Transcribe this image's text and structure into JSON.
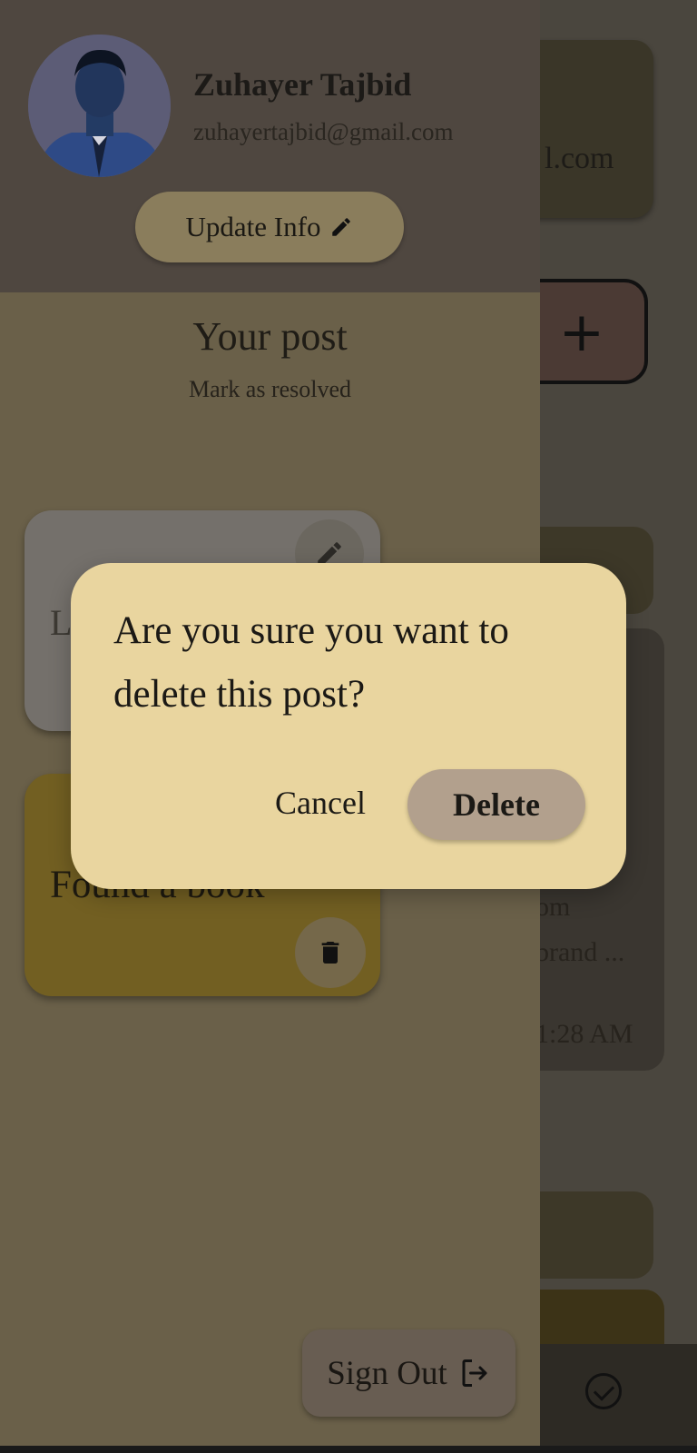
{
  "background": {
    "card_email_fragment": "l.com",
    "add_button_symbol": "+",
    "card_text_lines": [
      "om",
      "brand ...",
      "1:28 AM"
    ]
  },
  "drawer": {
    "user": {
      "name": "Zuhayer Tajbid",
      "email": "zuhayertajbid@gmail.com"
    },
    "update_button_label": "Update Info",
    "section_title": "Your post",
    "section_subtitle": "Mark as resolved",
    "posts": [
      {
        "title": "L",
        "action_icon": "pencil-icon"
      },
      {
        "title": "Found a book",
        "action_icon": "trash-icon"
      }
    ],
    "sign_out_label": "Sign Out"
  },
  "dialog": {
    "message": "Are you sure you want to delete this post?",
    "cancel_label": "Cancel",
    "delete_label": "Delete"
  },
  "colors": {
    "dialog_bg": "#e9d59f",
    "delete_button_bg": "#b2a08d",
    "drawer_bg": "#6a6049",
    "drawer_header_bg": "#4f4740"
  }
}
